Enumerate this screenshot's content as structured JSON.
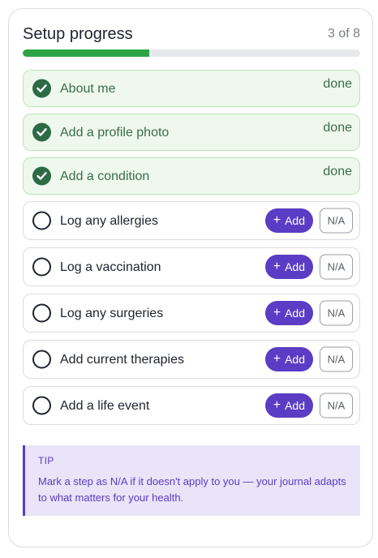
{
  "header": {
    "title": "Setup progress",
    "count": "3 of 8"
  },
  "progress": {
    "completed": 3,
    "total": 8,
    "fraction": 0.375
  },
  "colors": {
    "progress_fill": "#2ca445",
    "done_bg": "#eef8ec",
    "done_check": "#2d6a45",
    "accent": "#5b3cc4",
    "tip_bg": "#e9e4f8"
  },
  "steps": [
    {
      "label": "About me",
      "status": "done",
      "status_text": "done"
    },
    {
      "label": "Add a profile photo",
      "status": "done",
      "status_text": "done"
    },
    {
      "label": "Add a condition",
      "status": "done",
      "status_text": "done"
    },
    {
      "label": "Log any allergies",
      "status": "pending",
      "add_label": "Add",
      "na_label": "N/A"
    },
    {
      "label": "Log a vaccination",
      "status": "pending",
      "add_label": "Add",
      "na_label": "N/A"
    },
    {
      "label": "Log any surgeries",
      "status": "pending",
      "add_label": "Add",
      "na_label": "N/A"
    },
    {
      "label": "Add current therapies",
      "status": "pending",
      "add_label": "Add",
      "na_label": "N/A"
    },
    {
      "label": "Add a life event",
      "status": "pending",
      "add_label": "Add",
      "na_label": "N/A"
    }
  ],
  "tip": {
    "label": "TIP",
    "text": "Mark a step as N/A if it doesn't apply to you — your journal adapts to what matters for your health."
  },
  "icons": {
    "done": "check-circle-icon",
    "pending": "empty-circle-icon",
    "add": "plus-icon"
  }
}
